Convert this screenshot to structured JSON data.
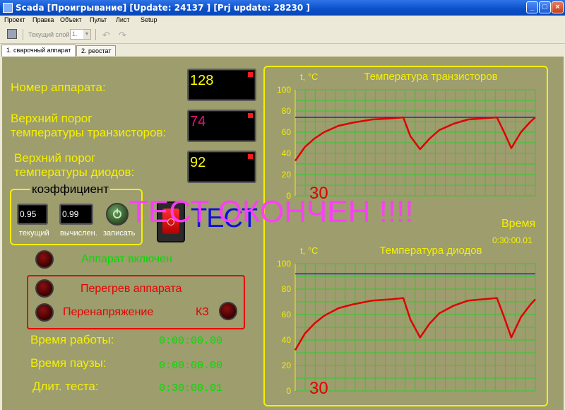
{
  "window": {
    "title": "Scada [Проигрывание] [Update: 24137 ] [Prj update: 28230 ]",
    "buttons": {
      "minimize": "_",
      "maximize": "□",
      "close": "×"
    }
  },
  "menu": [
    "Проект",
    "Правка",
    "Объект",
    "Пульт",
    "Лист",
    "Setup"
  ],
  "toolbar": {
    "layer_label": "Текущий слой",
    "layer_value": "1.",
    "undo_icon": "undo-arrow-icon",
    "redo_icon": "redo-arrow-icon"
  },
  "tabs": [
    {
      "label": "1. сварочный аппарат",
      "active": true
    },
    {
      "label": "2. реостат",
      "active": false
    }
  ],
  "panel": {
    "unit_number_label": "Номер аппарата:",
    "unit_number_value": "128",
    "trans_threshold_label_1": "Верхний порог",
    "trans_threshold_label_2": "температуры транзисторов:",
    "trans_threshold_value": "74",
    "diode_threshold_label_1": "Верхний порог",
    "diode_threshold_label_2": "температуры диодов:",
    "diode_threshold_value": "92",
    "coef_title": "коэффициент",
    "coef_current_value": "0.95",
    "coef_calc_value": "0.99",
    "coef_current_label": "текущий",
    "coef_calc_label": "вычислен.",
    "coef_save_label": "записать",
    "test_label": "ТЕСТ",
    "test_done_overlay": "ТЕСТ ОКОНЧЕН !!!!",
    "device_on_label": "Аппарат включен",
    "overheat_label": "Перегрев аппарата",
    "overvoltage_label": "Перенапряжение",
    "short_circuit_label": "КЗ",
    "work_time_label": "Время работы:",
    "work_time_value": "0:00:00.00",
    "pause_time_label": "Время паузы:",
    "pause_time_value": "0:00:00.00",
    "test_duration_label": "Длит. теста:",
    "test_duration_value": "0:30:00.01"
  },
  "chart_data": [
    {
      "type": "line",
      "title": "Температура транзисторов",
      "ylabel": "t, °C",
      "ylim": [
        0,
        100
      ],
      "yticks": [
        0,
        20,
        40,
        60,
        80,
        100
      ],
      "xlim": [
        0,
        100
      ],
      "grid": true,
      "threshold": 74,
      "overlay_value": "30",
      "time_label": "Время",
      "time_value": "0:30:00.01",
      "series": [
        {
          "x": [
            0,
            4,
            8,
            12,
            18,
            24,
            32,
            40,
            45,
            48,
            52,
            56,
            60,
            66,
            72,
            78,
            84,
            87,
            90,
            94,
            98,
            100
          ],
          "y": [
            33,
            46,
            54,
            60,
            66,
            69,
            72,
            73,
            74,
            56,
            44,
            54,
            62,
            68,
            72,
            73,
            74,
            60,
            45,
            60,
            70,
            74
          ]
        }
      ]
    },
    {
      "type": "line",
      "title": "Температура диодов",
      "ylabel": "t, °C",
      "ylim": [
        0,
        100
      ],
      "yticks": [
        0,
        20,
        40,
        60,
        80,
        100
      ],
      "xlim": [
        0,
        100
      ],
      "grid": true,
      "threshold": 92,
      "overlay_value": "30",
      "series": [
        {
          "x": [
            0,
            4,
            8,
            12,
            18,
            24,
            32,
            40,
            45,
            48,
            52,
            56,
            60,
            66,
            72,
            78,
            84,
            87,
            90,
            94,
            98,
            100
          ],
          "y": [
            32,
            45,
            53,
            59,
            65,
            68,
            71,
            72,
            73,
            56,
            42,
            53,
            61,
            67,
            71,
            72,
            73,
            58,
            42,
            58,
            68,
            72
          ]
        }
      ]
    }
  ]
}
